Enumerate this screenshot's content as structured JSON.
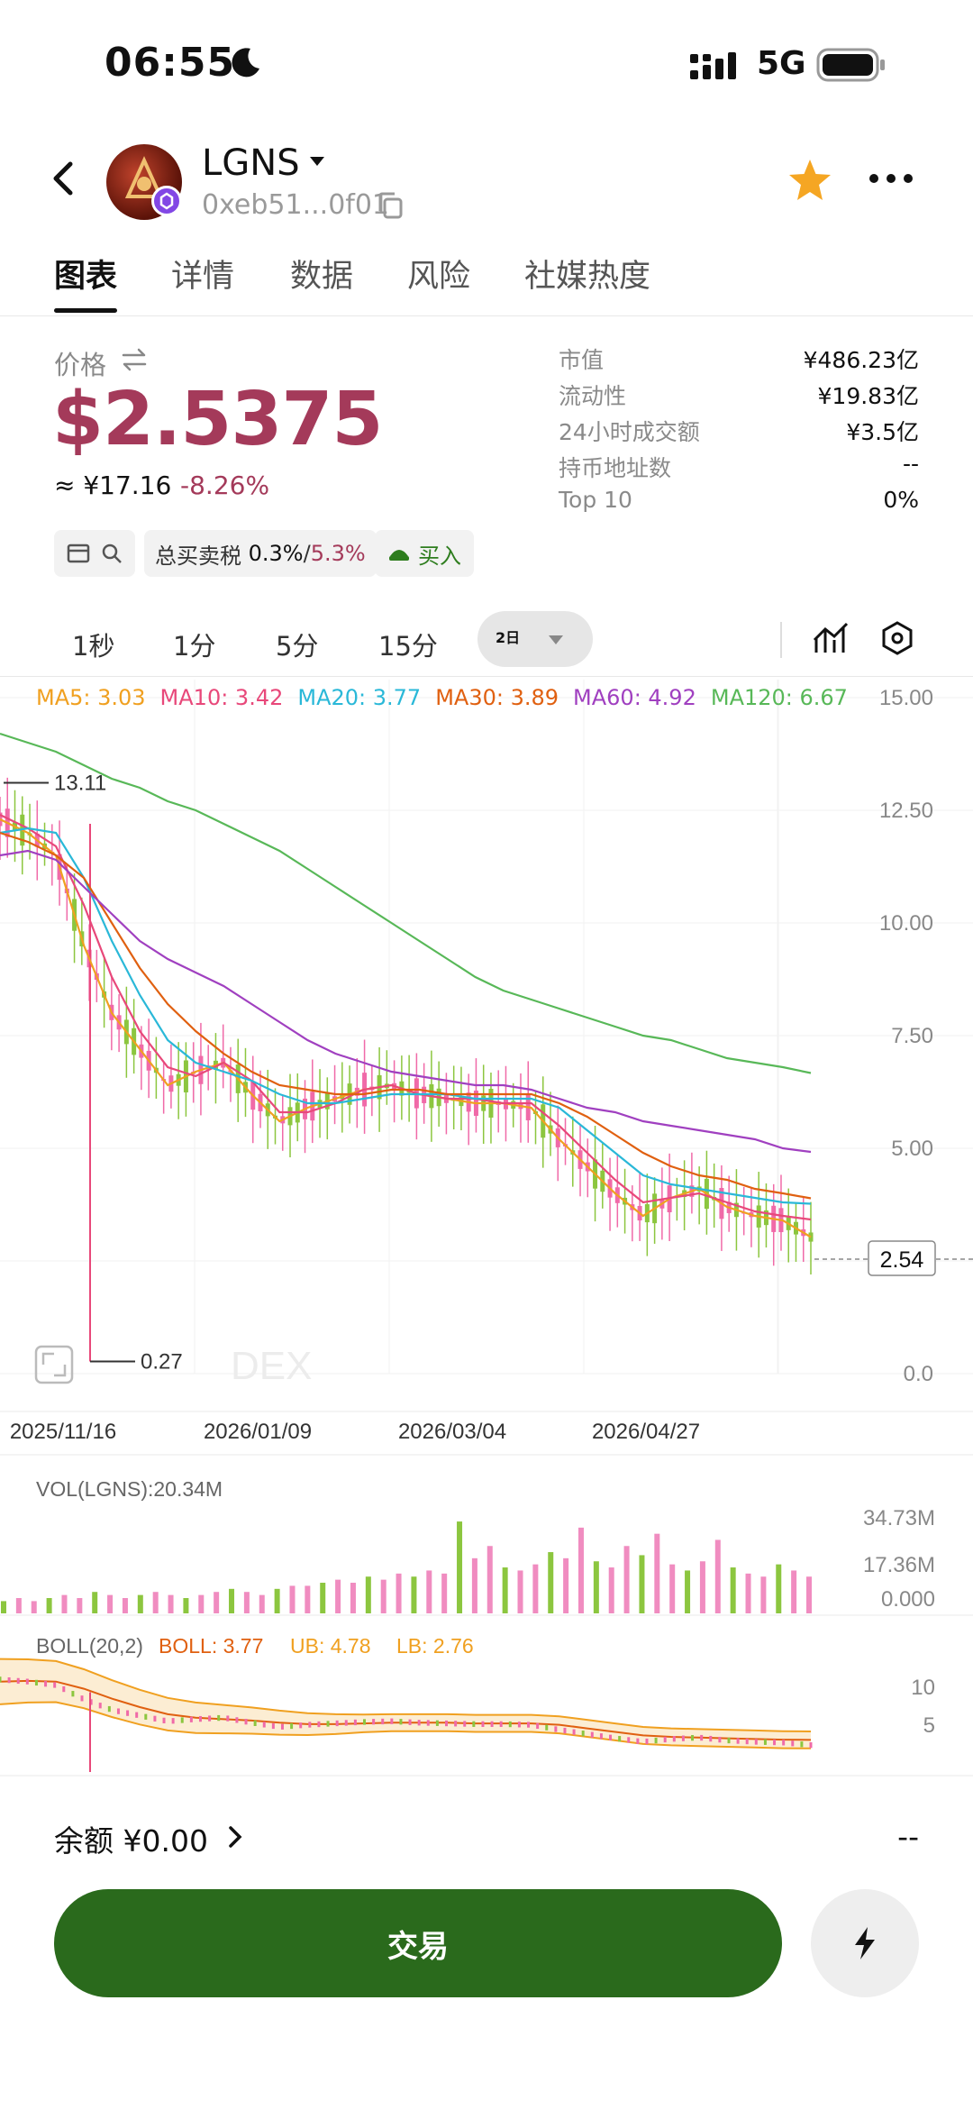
{
  "status_bar": {
    "time": "06:55",
    "network": "5G"
  },
  "header": {
    "token_name": "LGNS",
    "address": "0xeb51...0f01"
  },
  "tabs": [
    {
      "label": "图表",
      "active": true
    },
    {
      "label": "详情",
      "active": false
    },
    {
      "label": "数据",
      "active": false
    },
    {
      "label": "风险",
      "active": false
    },
    {
      "label": "社媒热度",
      "active": false
    }
  ],
  "price": {
    "label": "价格",
    "value": "$2.5375",
    "cny": "≈ ¥17.16",
    "change": "-8.26%",
    "change_color": "#a43a5a"
  },
  "stats": [
    {
      "label": "市值",
      "value": "¥486.23亿"
    },
    {
      "label": "流动性",
      "value": "¥19.83亿"
    },
    {
      "label": "24小时成交额",
      "value": "¥3.5亿"
    },
    {
      "label": "持币地址数",
      "value": "--"
    },
    {
      "label": "Top 10",
      "value": "0%"
    }
  ],
  "tax": {
    "label": "总买卖税",
    "buy": "0.3%",
    "sep": "/",
    "sell": "5.3%"
  },
  "buy_label": "买入",
  "timeframes": [
    "1秒",
    "1分",
    "5分",
    "15分"
  ],
  "timeframe_active": "2日",
  "ma_legend": [
    {
      "text": "MA5: 3.03",
      "color": "#f0a020"
    },
    {
      "text": "MA10: 3.42",
      "color": "#e8487a"
    },
    {
      "text": "MA20: 3.77",
      "color": "#2ab8d8"
    },
    {
      "text": "MA30: 3.89",
      "color": "#e06010"
    },
    {
      "text": "MA60: 4.92",
      "color": "#a040c0"
    },
    {
      "text": "MA120: 6.67",
      "color": "#58b858"
    }
  ],
  "chart_data": {
    "type": "line",
    "y_ticks": [
      "15.00",
      "12.50",
      "10.00",
      "7.50",
      "5.00",
      "2.50",
      "0.0"
    ],
    "ylim": [
      0,
      15
    ],
    "x_ticks": [
      "2025/11/16",
      "2026/01/09",
      "2026/03/04",
      "2026/04/27"
    ],
    "high_label": "13.11",
    "low_label": "0.27",
    "last_price_label": "2.54",
    "watermark": "DEX",
    "series": [
      {
        "name": "MA5",
        "color": "#f0a020",
        "values": [
          12.3,
          12.0,
          11.5,
          9.5,
          8.0,
          7.2,
          6.4,
          6.7,
          6.9,
          6.2,
          5.6,
          5.9,
          6.1,
          6.3,
          6.4,
          6.2,
          6.1,
          6.0,
          6.0,
          5.9,
          5.2,
          4.6,
          4.0,
          3.5,
          3.9,
          4.1,
          3.7,
          3.5,
          3.4,
          3.03
        ]
      },
      {
        "name": "MA10",
        "color": "#e8487a",
        "values": [
          12.4,
          12.1,
          11.7,
          10.4,
          8.8,
          7.6,
          6.8,
          6.6,
          6.9,
          6.5,
          5.8,
          5.8,
          6.0,
          6.3,
          6.4,
          6.2,
          6.1,
          6.1,
          6.0,
          6.0,
          5.5,
          4.9,
          4.3,
          3.8,
          3.9,
          4.0,
          3.8,
          3.6,
          3.5,
          3.42
        ]
      },
      {
        "name": "MA20",
        "color": "#2ab8d8",
        "values": [
          12.0,
          12.1,
          12.0,
          11.0,
          9.6,
          8.4,
          7.4,
          6.9,
          6.7,
          6.5,
          6.2,
          6.0,
          6.0,
          6.1,
          6.2,
          6.2,
          6.2,
          6.1,
          6.1,
          6.1,
          5.9,
          5.4,
          4.9,
          4.4,
          4.2,
          4.1,
          4.0,
          3.9,
          3.8,
          3.77
        ]
      },
      {
        "name": "MA30",
        "color": "#e06010",
        "values": [
          12.0,
          11.8,
          11.5,
          11.0,
          10.0,
          9.0,
          8.2,
          7.6,
          7.1,
          6.7,
          6.4,
          6.3,
          6.2,
          6.2,
          6.3,
          6.3,
          6.2,
          6.2,
          6.2,
          6.2,
          6.0,
          5.7,
          5.3,
          4.9,
          4.6,
          4.4,
          4.3,
          4.1,
          4.0,
          3.89
        ]
      },
      {
        "name": "MA60",
        "color": "#a040c0",
        "values": [
          11.5,
          11.6,
          11.4,
          10.8,
          10.2,
          9.6,
          9.2,
          8.9,
          8.6,
          8.2,
          7.8,
          7.4,
          7.1,
          6.9,
          6.7,
          6.6,
          6.5,
          6.4,
          6.4,
          6.3,
          6.1,
          5.9,
          5.8,
          5.6,
          5.5,
          5.4,
          5.3,
          5.2,
          5.0,
          4.92
        ]
      },
      {
        "name": "MA120",
        "color": "#58b858",
        "values": [
          14.2,
          14.0,
          13.8,
          13.5,
          13.2,
          13.0,
          12.7,
          12.5,
          12.2,
          11.9,
          11.6,
          11.2,
          10.8,
          10.4,
          10.0,
          9.6,
          9.2,
          8.8,
          8.5,
          8.3,
          8.1,
          7.9,
          7.7,
          7.5,
          7.4,
          7.2,
          7.0,
          6.9,
          6.8,
          6.67
        ]
      }
    ],
    "volume": {
      "label": "VOL(LGNS):20.34M",
      "ticks": [
        "34.73M",
        "17.36M",
        "0.000"
      ],
      "max": 34.73,
      "values": [
        4,
        5,
        4,
        5,
        6,
        5,
        7,
        6,
        5,
        6,
        7,
        6,
        5,
        6,
        7,
        8,
        7,
        6,
        8,
        9,
        9,
        10,
        11,
        10,
        12,
        11,
        13,
        12,
        14,
        13,
        30,
        18,
        22,
        15,
        14,
        16,
        20,
        18,
        28,
        17,
        15,
        22,
        19,
        26,
        16,
        14,
        17,
        24,
        15,
        13,
        12,
        16,
        14,
        12
      ]
    },
    "boll": {
      "label": "BOLL(20,2)",
      "boll": "BOLL: 3.77",
      "ub": "UB: 4.78",
      "lb": "LB: 2.76",
      "ticks": [
        "10",
        "5"
      ]
    }
  },
  "balance": {
    "label": "余额 ¥0.00",
    "right": "--"
  },
  "trade_label": "交易"
}
